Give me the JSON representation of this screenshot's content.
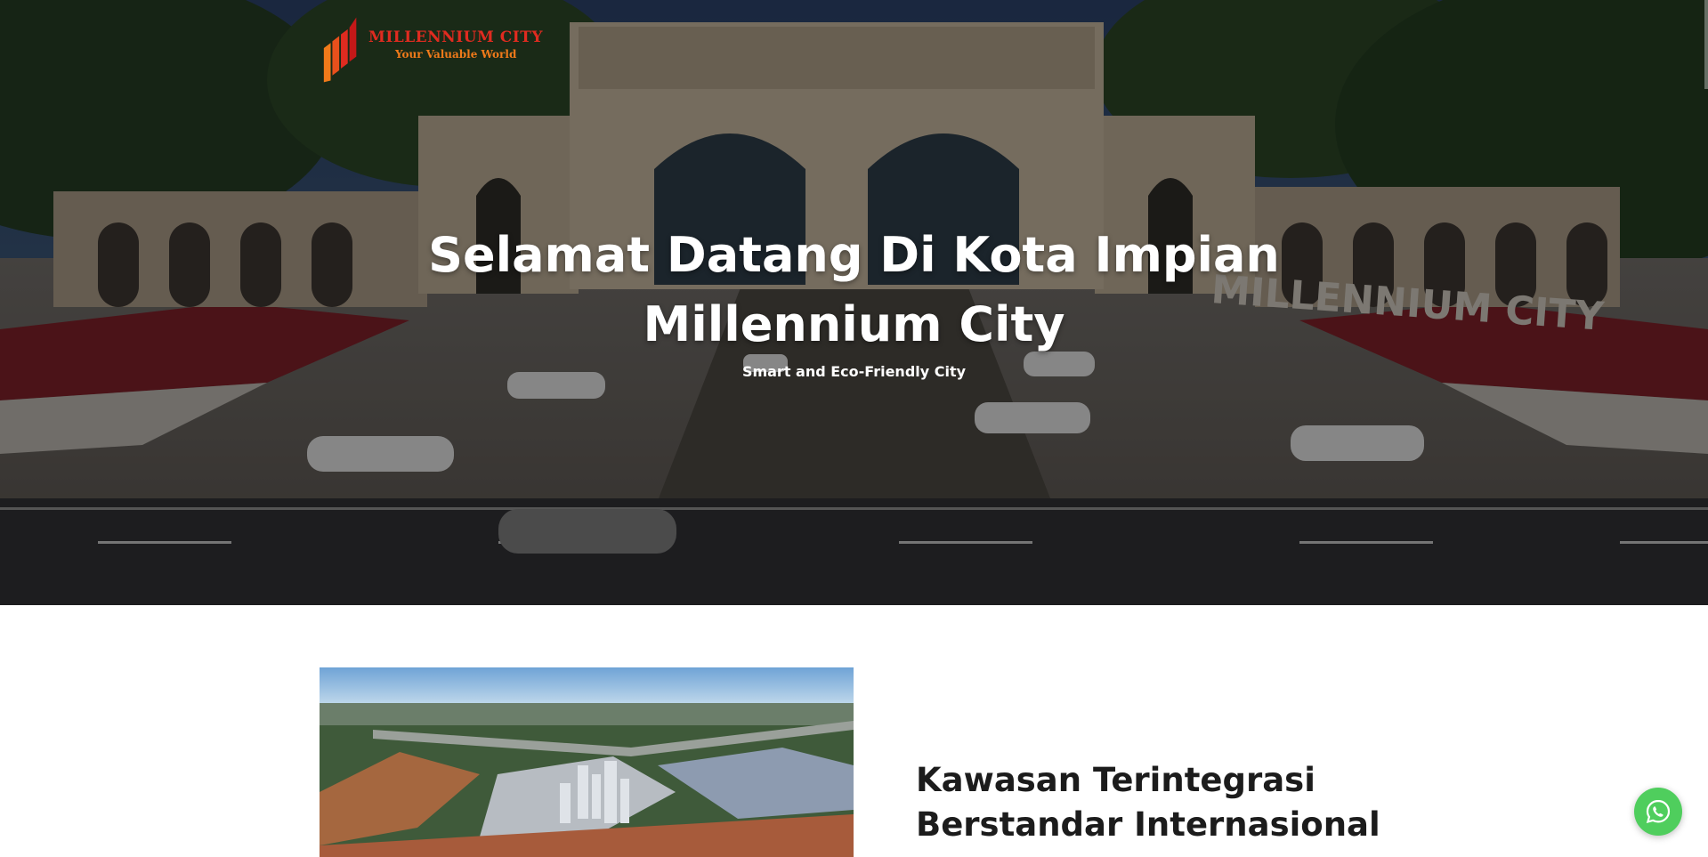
{
  "logo": {
    "brand": "MILLENNIUM CITY",
    "tagline": "Your Valuable World"
  },
  "hero": {
    "title_line1": "Selamat Datang Di Kota Impian",
    "title_line2": "Millennium City",
    "subtitle": "Smart and Eco-Friendly City",
    "gate_inscription": "MILLENNIUM CITY"
  },
  "section": {
    "heading_line1": "Kawasan Terintegrasi",
    "heading_line2": "Berstandar Internasional"
  },
  "floating": {
    "whatsapp_icon": "whatsapp-icon"
  },
  "colors": {
    "brand_red": "#e02b20",
    "brand_orange": "#f07a1a",
    "whatsapp_green": "#4fce5d",
    "heading_text": "#1c1c1c"
  }
}
